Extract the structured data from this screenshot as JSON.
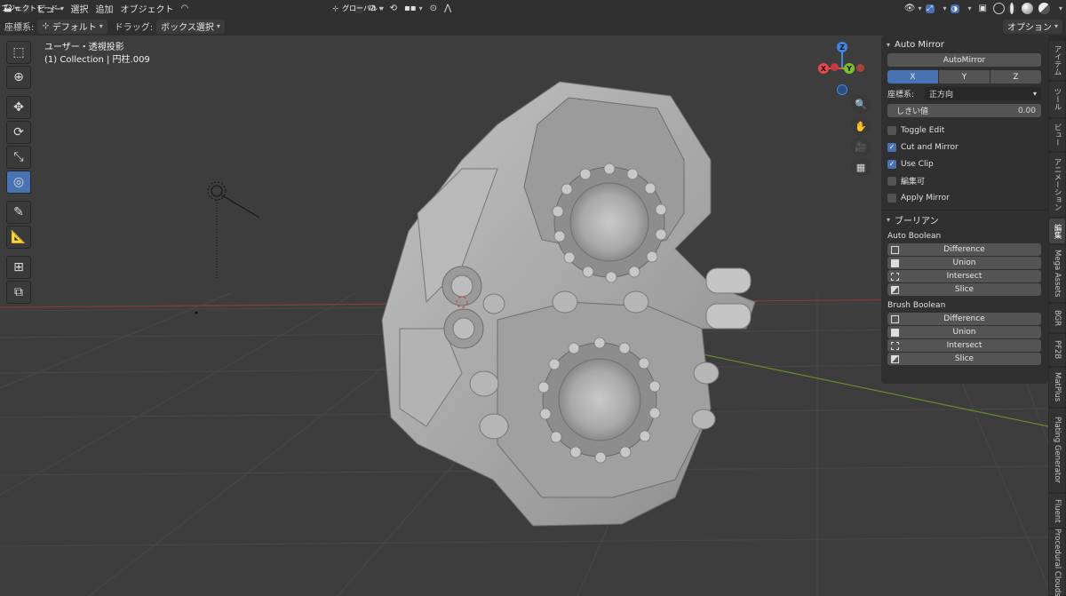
{
  "header": {
    "mode": "オブジェクトモード",
    "menus": [
      "ビュー",
      "選択",
      "追加",
      "オブジェクト"
    ],
    "orientation": "グローバル"
  },
  "toolsettings": {
    "coord_label": "座標系:",
    "coord_value": "デフォルト",
    "drag_label": "ドラッグ:",
    "drag_value": "ボックス選択",
    "options": "オプション"
  },
  "viewport": {
    "view_name": "ユーザー・透視投影",
    "collection": "(1) Collection | 円柱.009",
    "gizmo": {
      "x": "X",
      "y": "Y",
      "z": "Z"
    }
  },
  "auto_mirror": {
    "title": "Auto Mirror",
    "button": "AutoMirror",
    "axes": [
      "X",
      "Y",
      "Z"
    ],
    "selected_axis": "X",
    "orientation_label": "座標系:",
    "orientation_value": "正方向",
    "threshold_label": "しきい値",
    "threshold_value": "0.00",
    "checks": [
      {
        "label": "Toggle Edit",
        "checked": false
      },
      {
        "label": "Cut and Mirror",
        "checked": true
      },
      {
        "label": "Use Clip",
        "checked": true
      },
      {
        "label": "編集可",
        "checked": false
      },
      {
        "label": "Apply Mirror",
        "checked": false
      }
    ]
  },
  "boolean": {
    "title": "ブーリアン",
    "auto_label": "Auto Boolean",
    "auto_ops": [
      "Difference",
      "Union",
      "Intersect",
      "Slice"
    ],
    "brush_label": "Brush Boolean",
    "brush_ops": [
      "Difference",
      "Union",
      "Intersect",
      "Slice"
    ]
  },
  "side_tabs": [
    "アイテム",
    "ツール",
    "ビュー",
    "アニメーション",
    "編集",
    "Mega Assets",
    "BGR",
    "PF2B",
    "MatPlus",
    "Plating Generator",
    "Fluent",
    "Procedural Clouds"
  ],
  "colors": {
    "accent": "#4772b3",
    "x_axis": "#e8474f",
    "y_axis": "#7fbf2b",
    "z_axis": "#3f87e3"
  }
}
